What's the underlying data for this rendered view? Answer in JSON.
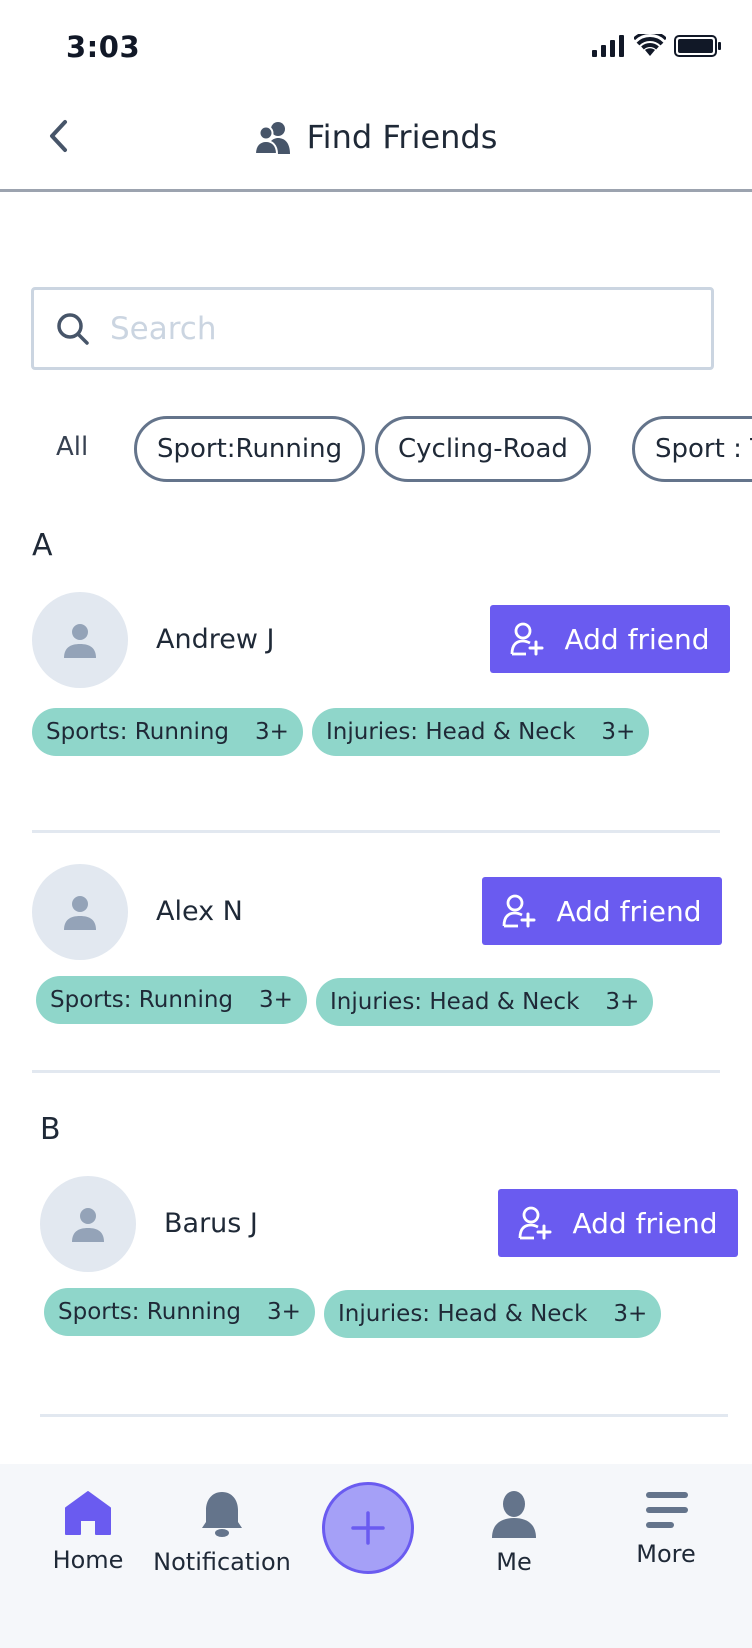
{
  "status": {
    "time": "3:03"
  },
  "header": {
    "title": "Find Friends"
  },
  "search": {
    "placeholder": "Search",
    "value": ""
  },
  "filters": {
    "all": "All",
    "chips": [
      "Sport:Running",
      "Cycling-Road",
      "Sport : T"
    ]
  },
  "sections": [
    {
      "letter": "A",
      "friends": [
        {
          "name": "Andrew J",
          "button": "Add friend",
          "tags": [
            {
              "label": "Sports:  Running",
              "count": "3+"
            },
            {
              "label": "Injuries: Head & Neck",
              "count": "3+"
            }
          ]
        },
        {
          "name": "Alex N",
          "button": "Add friend",
          "tags": [
            {
              "label": "Sports:  Running",
              "count": "3+"
            },
            {
              "label": "Injuries: Head & Neck",
              "count": "3+"
            }
          ]
        }
      ]
    },
    {
      "letter": "B",
      "friends": [
        {
          "name": "Barus J",
          "button": "Add friend",
          "tags": [
            {
              "label": "Sports:  Running",
              "count": "3+"
            },
            {
              "label": "Injuries: Head & Neck",
              "count": "3+"
            }
          ]
        }
      ]
    }
  ],
  "nav": {
    "home": "Home",
    "notification": "Notification",
    "me": "Me",
    "more": "More"
  },
  "colors": {
    "accent": "#6a5bf0",
    "tag": "#8fd6ca",
    "fab": "#a5a0f7"
  },
  "icons": [
    "back-chevron-icon",
    "friends-icon",
    "search-icon",
    "add-person-icon",
    "person-icon",
    "home-icon",
    "bell-icon",
    "plus-icon",
    "user-icon",
    "menu-icon"
  ]
}
